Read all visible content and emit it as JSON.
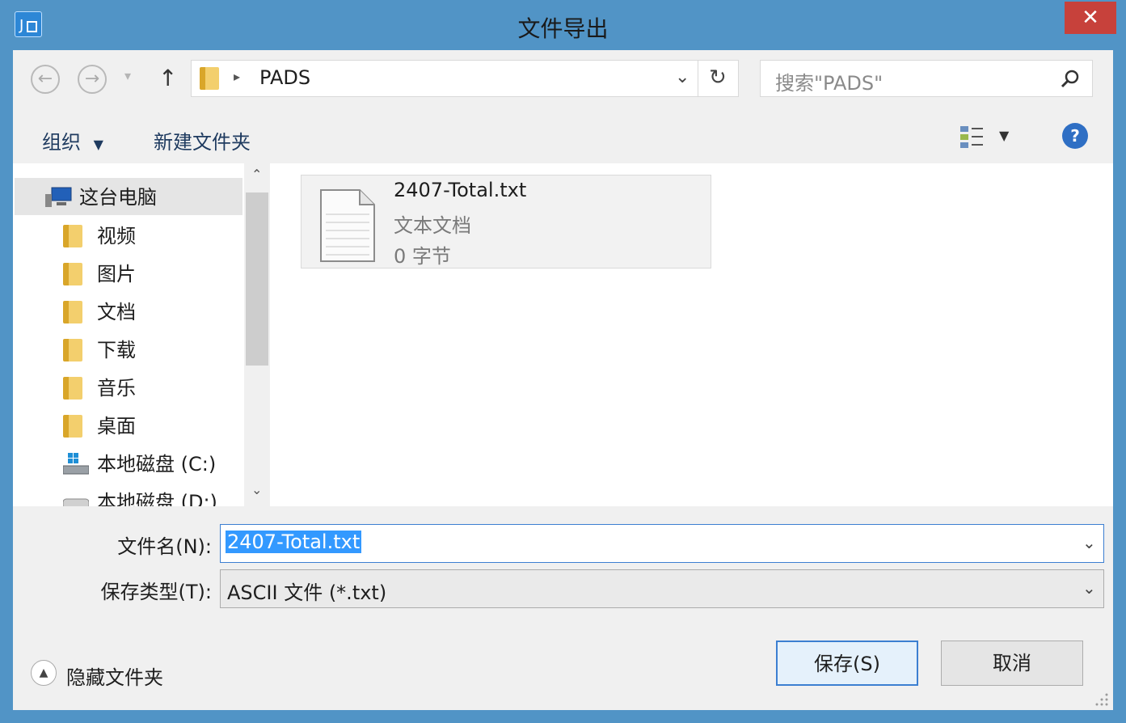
{
  "window": {
    "title": "文件导出",
    "close_label": "✕"
  },
  "nav_bar": {
    "breadcrumb": "PADS",
    "search_placeholder": "搜索\"PADS\""
  },
  "toolbar": {
    "organize_label": "组织",
    "new_folder_label": "新建文件夹"
  },
  "sidebar": {
    "items": [
      {
        "label": "这台电脑",
        "icon": "computer-icon"
      },
      {
        "label": "视频",
        "icon": "videos-folder-icon"
      },
      {
        "label": "图片",
        "icon": "pictures-folder-icon"
      },
      {
        "label": "文档",
        "icon": "documents-folder-icon"
      },
      {
        "label": "下载",
        "icon": "downloads-folder-icon"
      },
      {
        "label": "音乐",
        "icon": "music-folder-icon"
      },
      {
        "label": "桌面",
        "icon": "desktop-folder-icon"
      },
      {
        "label": "本地磁盘 (C:)",
        "icon": "drive-icon"
      },
      {
        "label": "本地磁盘 (D:)",
        "icon": "drive-icon"
      }
    ]
  },
  "files": [
    {
      "name": "2407-Total.txt",
      "type": "文本文档",
      "size": "0 字节"
    }
  ],
  "form": {
    "filename_label": "文件名(N):",
    "filename_value": "2407-Total.txt",
    "filetype_label": "保存类型(T):",
    "filetype_value": "ASCII 文件 (*.txt)"
  },
  "footer": {
    "hide_folders_label": "隐藏文件夹",
    "save_label": "保存(S)",
    "cancel_label": "取消"
  },
  "colors": {
    "frame": "#5194c6",
    "close": "#c7413b",
    "selection": "#3399ff"
  }
}
